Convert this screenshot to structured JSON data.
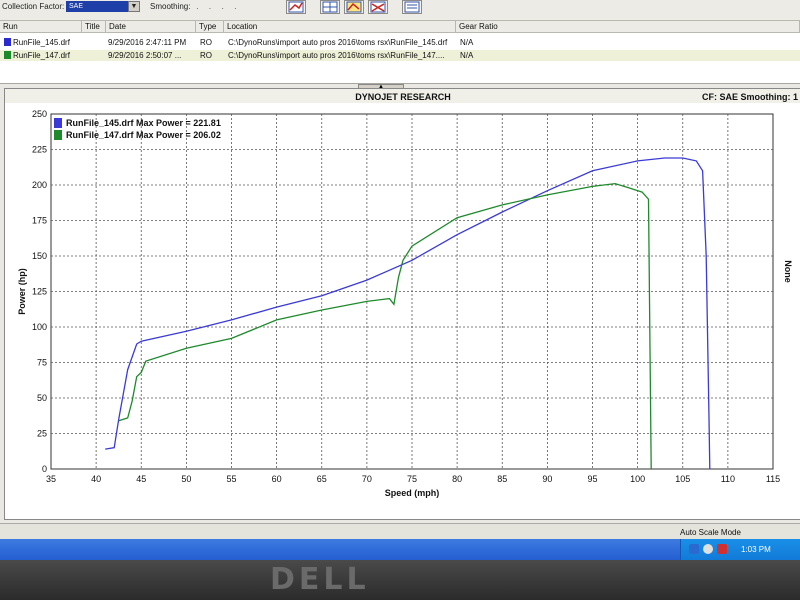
{
  "toolbar": {
    "collection_factor_label": "Collection Factor:",
    "collection_factor_value": "SAE",
    "smoothing_label": "Smoothing:"
  },
  "run_table": {
    "columns": [
      "Run",
      "Title",
      "Date",
      "Type",
      "Location",
      "Gear Ratio"
    ],
    "rows": [
      {
        "run": "RunFile_145.drf",
        "title": "",
        "date": "9/29/2016 2:47:11 PM",
        "type": "RO",
        "location": "C:\\DynoRuns\\import auto pros 2016\\toms rsx\\RunFile_145.drf",
        "gear_ratio": "N/A",
        "color": "#2a2ad0"
      },
      {
        "run": "RunFile_147.drf",
        "title": "",
        "date": "9/29/2016 2:50:07 ...",
        "type": "RO",
        "location": "C:\\DynoRuns\\import auto pros 2016\\toms rsx\\RunFile_147....",
        "gear_ratio": "N/A",
        "color": "#1a8a2a"
      }
    ]
  },
  "chart_header": {
    "title": "DYNOJET RESEARCH",
    "right_info": "CF: SAE  Smoothing: 1",
    "right_side_label": "None"
  },
  "chart_data": {
    "type": "line",
    "xlabel": "Speed (mph)",
    "ylabel": "Power (hp)",
    "xlim": [
      35,
      115
    ],
    "ylim": [
      0,
      250
    ],
    "xticks": [
      35,
      40,
      45,
      50,
      55,
      60,
      65,
      70,
      75,
      80,
      85,
      90,
      95,
      100,
      105,
      110,
      115
    ],
    "yticks": [
      0,
      25,
      50,
      75,
      100,
      125,
      150,
      175,
      200,
      225,
      250
    ],
    "grid": true,
    "legend_placement": "top-left",
    "series": [
      {
        "name": "RunFile_145.drf Max Power = 221.81",
        "color": "#3a3ad8",
        "x": [
          41.0,
          42.0,
          42.5,
          43.5,
          44.5,
          45.0,
          50,
          55,
          60,
          65,
          70,
          75,
          80,
          85,
          90,
          95,
          100,
          103,
          105,
          106.5,
          107.2,
          107.6,
          107.9,
          108.0
        ],
        "y": [
          14,
          15,
          35,
          70,
          88,
          90,
          97,
          105,
          114,
          122,
          133,
          147,
          165,
          181,
          196,
          210,
          217,
          219,
          219,
          217,
          210,
          150,
          40,
          0
        ]
      },
      {
        "name": "RunFile_147.drf Max Power = 206.02",
        "color": "#1f8a2c",
        "x": [
          42.5,
          43.5,
          44.0,
          44.5,
          45.0,
          45.5,
          50,
          55,
          60,
          65,
          70,
          72.5,
          73.0,
          73.5,
          74.0,
          75,
          80,
          85,
          90,
          95,
          97.5,
          99,
          100.5,
          101.2,
          101.5
        ],
        "y": [
          34,
          36,
          48,
          65,
          68,
          76,
          85,
          92,
          105,
          112,
          118,
          120,
          116,
          135,
          147,
          157,
          177,
          186,
          193,
          199,
          201,
          198,
          195,
          190,
          0
        ]
      }
    ]
  },
  "status_bar": {
    "auto_scale": "Auto Scale Mode"
  },
  "taskbar": {
    "clock": "1:03 PM"
  },
  "monitor": {
    "brand": "DELL"
  }
}
